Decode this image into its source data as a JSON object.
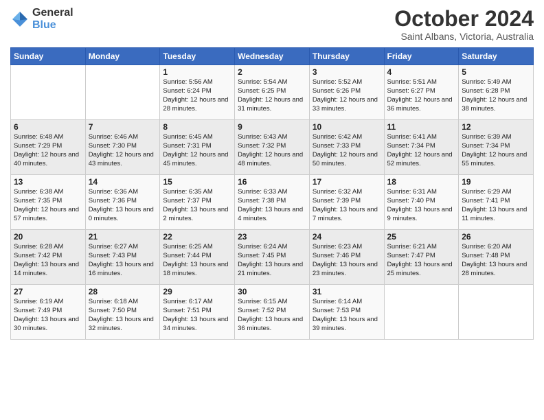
{
  "header": {
    "logo_line1": "General",
    "logo_line2": "Blue",
    "month": "October 2024",
    "location": "Saint Albans, Victoria, Australia"
  },
  "days_of_week": [
    "Sunday",
    "Monday",
    "Tuesday",
    "Wednesday",
    "Thursday",
    "Friday",
    "Saturday"
  ],
  "weeks": [
    [
      {
        "day": "",
        "info": ""
      },
      {
        "day": "",
        "info": ""
      },
      {
        "day": "1",
        "info": "Sunrise: 5:56 AM\nSunset: 6:24 PM\nDaylight: 12 hours and 28 minutes."
      },
      {
        "day": "2",
        "info": "Sunrise: 5:54 AM\nSunset: 6:25 PM\nDaylight: 12 hours and 31 minutes."
      },
      {
        "day": "3",
        "info": "Sunrise: 5:52 AM\nSunset: 6:26 PM\nDaylight: 12 hours and 33 minutes."
      },
      {
        "day": "4",
        "info": "Sunrise: 5:51 AM\nSunset: 6:27 PM\nDaylight: 12 hours and 36 minutes."
      },
      {
        "day": "5",
        "info": "Sunrise: 5:49 AM\nSunset: 6:28 PM\nDaylight: 12 hours and 38 minutes."
      }
    ],
    [
      {
        "day": "6",
        "info": "Sunrise: 6:48 AM\nSunset: 7:29 PM\nDaylight: 12 hours and 40 minutes."
      },
      {
        "day": "7",
        "info": "Sunrise: 6:46 AM\nSunset: 7:30 PM\nDaylight: 12 hours and 43 minutes."
      },
      {
        "day": "8",
        "info": "Sunrise: 6:45 AM\nSunset: 7:31 PM\nDaylight: 12 hours and 45 minutes."
      },
      {
        "day": "9",
        "info": "Sunrise: 6:43 AM\nSunset: 7:32 PM\nDaylight: 12 hours and 48 minutes."
      },
      {
        "day": "10",
        "info": "Sunrise: 6:42 AM\nSunset: 7:33 PM\nDaylight: 12 hours and 50 minutes."
      },
      {
        "day": "11",
        "info": "Sunrise: 6:41 AM\nSunset: 7:34 PM\nDaylight: 12 hours and 52 minutes."
      },
      {
        "day": "12",
        "info": "Sunrise: 6:39 AM\nSunset: 7:34 PM\nDaylight: 12 hours and 55 minutes."
      }
    ],
    [
      {
        "day": "13",
        "info": "Sunrise: 6:38 AM\nSunset: 7:35 PM\nDaylight: 12 hours and 57 minutes."
      },
      {
        "day": "14",
        "info": "Sunrise: 6:36 AM\nSunset: 7:36 PM\nDaylight: 13 hours and 0 minutes."
      },
      {
        "day": "15",
        "info": "Sunrise: 6:35 AM\nSunset: 7:37 PM\nDaylight: 13 hours and 2 minutes."
      },
      {
        "day": "16",
        "info": "Sunrise: 6:33 AM\nSunset: 7:38 PM\nDaylight: 13 hours and 4 minutes."
      },
      {
        "day": "17",
        "info": "Sunrise: 6:32 AM\nSunset: 7:39 PM\nDaylight: 13 hours and 7 minutes."
      },
      {
        "day": "18",
        "info": "Sunrise: 6:31 AM\nSunset: 7:40 PM\nDaylight: 13 hours and 9 minutes."
      },
      {
        "day": "19",
        "info": "Sunrise: 6:29 AM\nSunset: 7:41 PM\nDaylight: 13 hours and 11 minutes."
      }
    ],
    [
      {
        "day": "20",
        "info": "Sunrise: 6:28 AM\nSunset: 7:42 PM\nDaylight: 13 hours and 14 minutes."
      },
      {
        "day": "21",
        "info": "Sunrise: 6:27 AM\nSunset: 7:43 PM\nDaylight: 13 hours and 16 minutes."
      },
      {
        "day": "22",
        "info": "Sunrise: 6:25 AM\nSunset: 7:44 PM\nDaylight: 13 hours and 18 minutes."
      },
      {
        "day": "23",
        "info": "Sunrise: 6:24 AM\nSunset: 7:45 PM\nDaylight: 13 hours and 21 minutes."
      },
      {
        "day": "24",
        "info": "Sunrise: 6:23 AM\nSunset: 7:46 PM\nDaylight: 13 hours and 23 minutes."
      },
      {
        "day": "25",
        "info": "Sunrise: 6:21 AM\nSunset: 7:47 PM\nDaylight: 13 hours and 25 minutes."
      },
      {
        "day": "26",
        "info": "Sunrise: 6:20 AM\nSunset: 7:48 PM\nDaylight: 13 hours and 28 minutes."
      }
    ],
    [
      {
        "day": "27",
        "info": "Sunrise: 6:19 AM\nSunset: 7:49 PM\nDaylight: 13 hours and 30 minutes."
      },
      {
        "day": "28",
        "info": "Sunrise: 6:18 AM\nSunset: 7:50 PM\nDaylight: 13 hours and 32 minutes."
      },
      {
        "day": "29",
        "info": "Sunrise: 6:17 AM\nSunset: 7:51 PM\nDaylight: 13 hours and 34 minutes."
      },
      {
        "day": "30",
        "info": "Sunrise: 6:15 AM\nSunset: 7:52 PM\nDaylight: 13 hours and 36 minutes."
      },
      {
        "day": "31",
        "info": "Sunrise: 6:14 AM\nSunset: 7:53 PM\nDaylight: 13 hours and 39 minutes."
      },
      {
        "day": "",
        "info": ""
      },
      {
        "day": "",
        "info": ""
      }
    ]
  ]
}
